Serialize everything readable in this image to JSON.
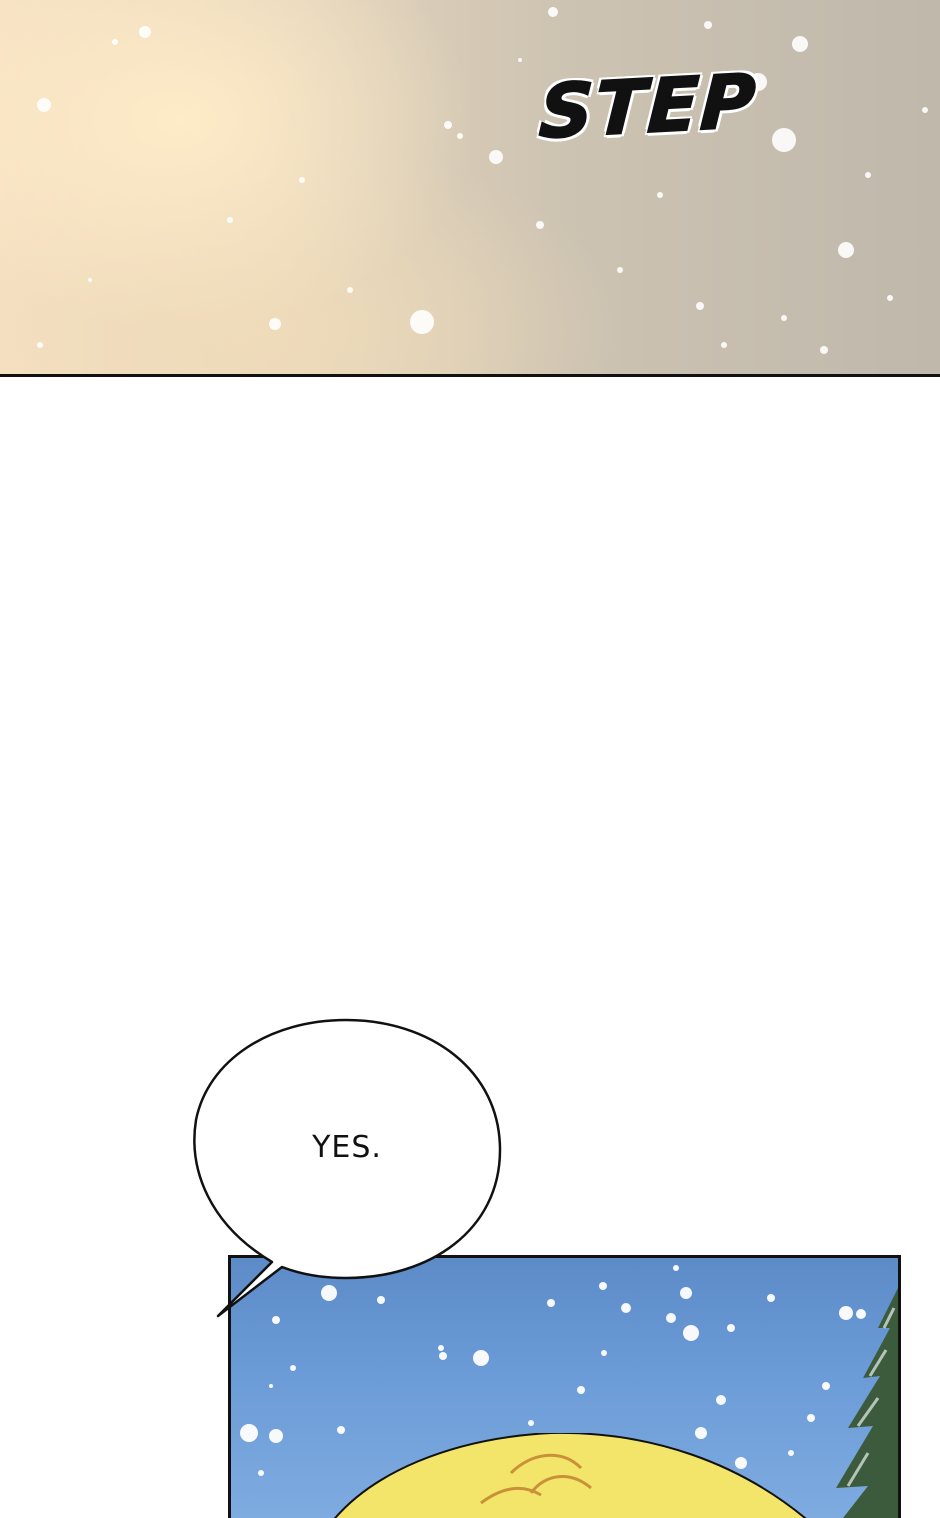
{
  "panels": {
    "top": {
      "sfx_text": "STEP",
      "colors": {
        "warm_light": "#f6e2c3",
        "haze": "#c7bfb1",
        "border": "#111111"
      }
    },
    "middle": {
      "speech_bubble_text": "YES."
    },
    "bottom": {
      "colors": {
        "sky": "#6a9ad6",
        "hair": "#f3e46a",
        "tree": "#3c5a3c",
        "border": "#111111"
      }
    }
  }
}
